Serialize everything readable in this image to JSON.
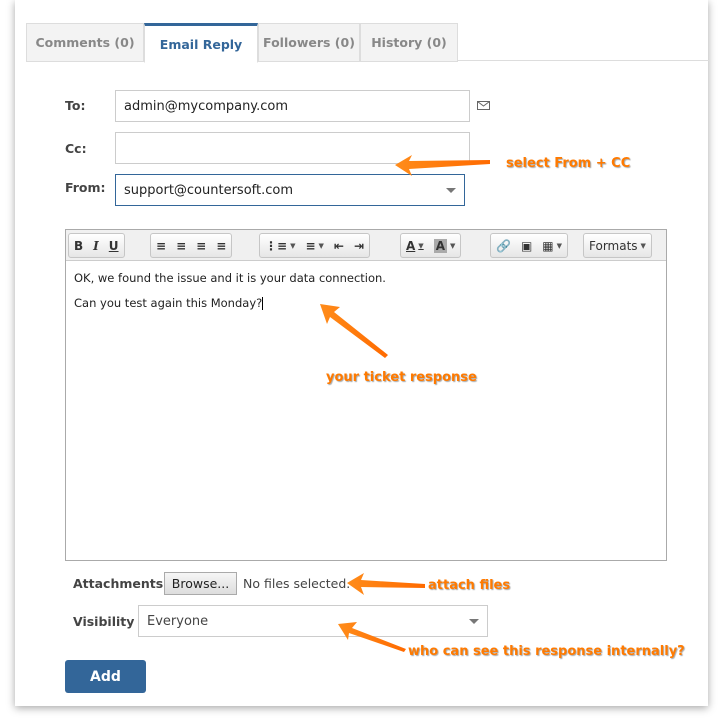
{
  "tabs": [
    {
      "label": "Comments (0)"
    },
    {
      "label": "Email Reply",
      "active": true
    },
    {
      "label": "Followers (0)"
    },
    {
      "label": "History (0)"
    }
  ],
  "form": {
    "to_label": "To:",
    "to_value": "admin@mycompany.com",
    "cc_label": "Cc:",
    "cc_value": "",
    "from_label": "From:",
    "from_value": "support@countersoft.com",
    "attachments_label": "Attachments",
    "browse_label": "Browse...",
    "no_files": "No files selected.",
    "visibility_label": "Visibility",
    "visibility_value": "Everyone",
    "add_label": "Add"
  },
  "editor": {
    "toolbar": {
      "bold": "B",
      "italic": "I",
      "underline": "U",
      "text_color": "A",
      "bg_color": "A",
      "formats": "Formats"
    },
    "lines": [
      "OK, we found the issue and it is your data connection.",
      "Can you test again this Monday?"
    ]
  },
  "annotations": {
    "from_cc": "select From + CC",
    "response": "your ticket response",
    "attach": "attach files",
    "visibility": "who can see this response internally?"
  },
  "colors": {
    "accent": "#336699",
    "annotation": "#ff7a00"
  }
}
